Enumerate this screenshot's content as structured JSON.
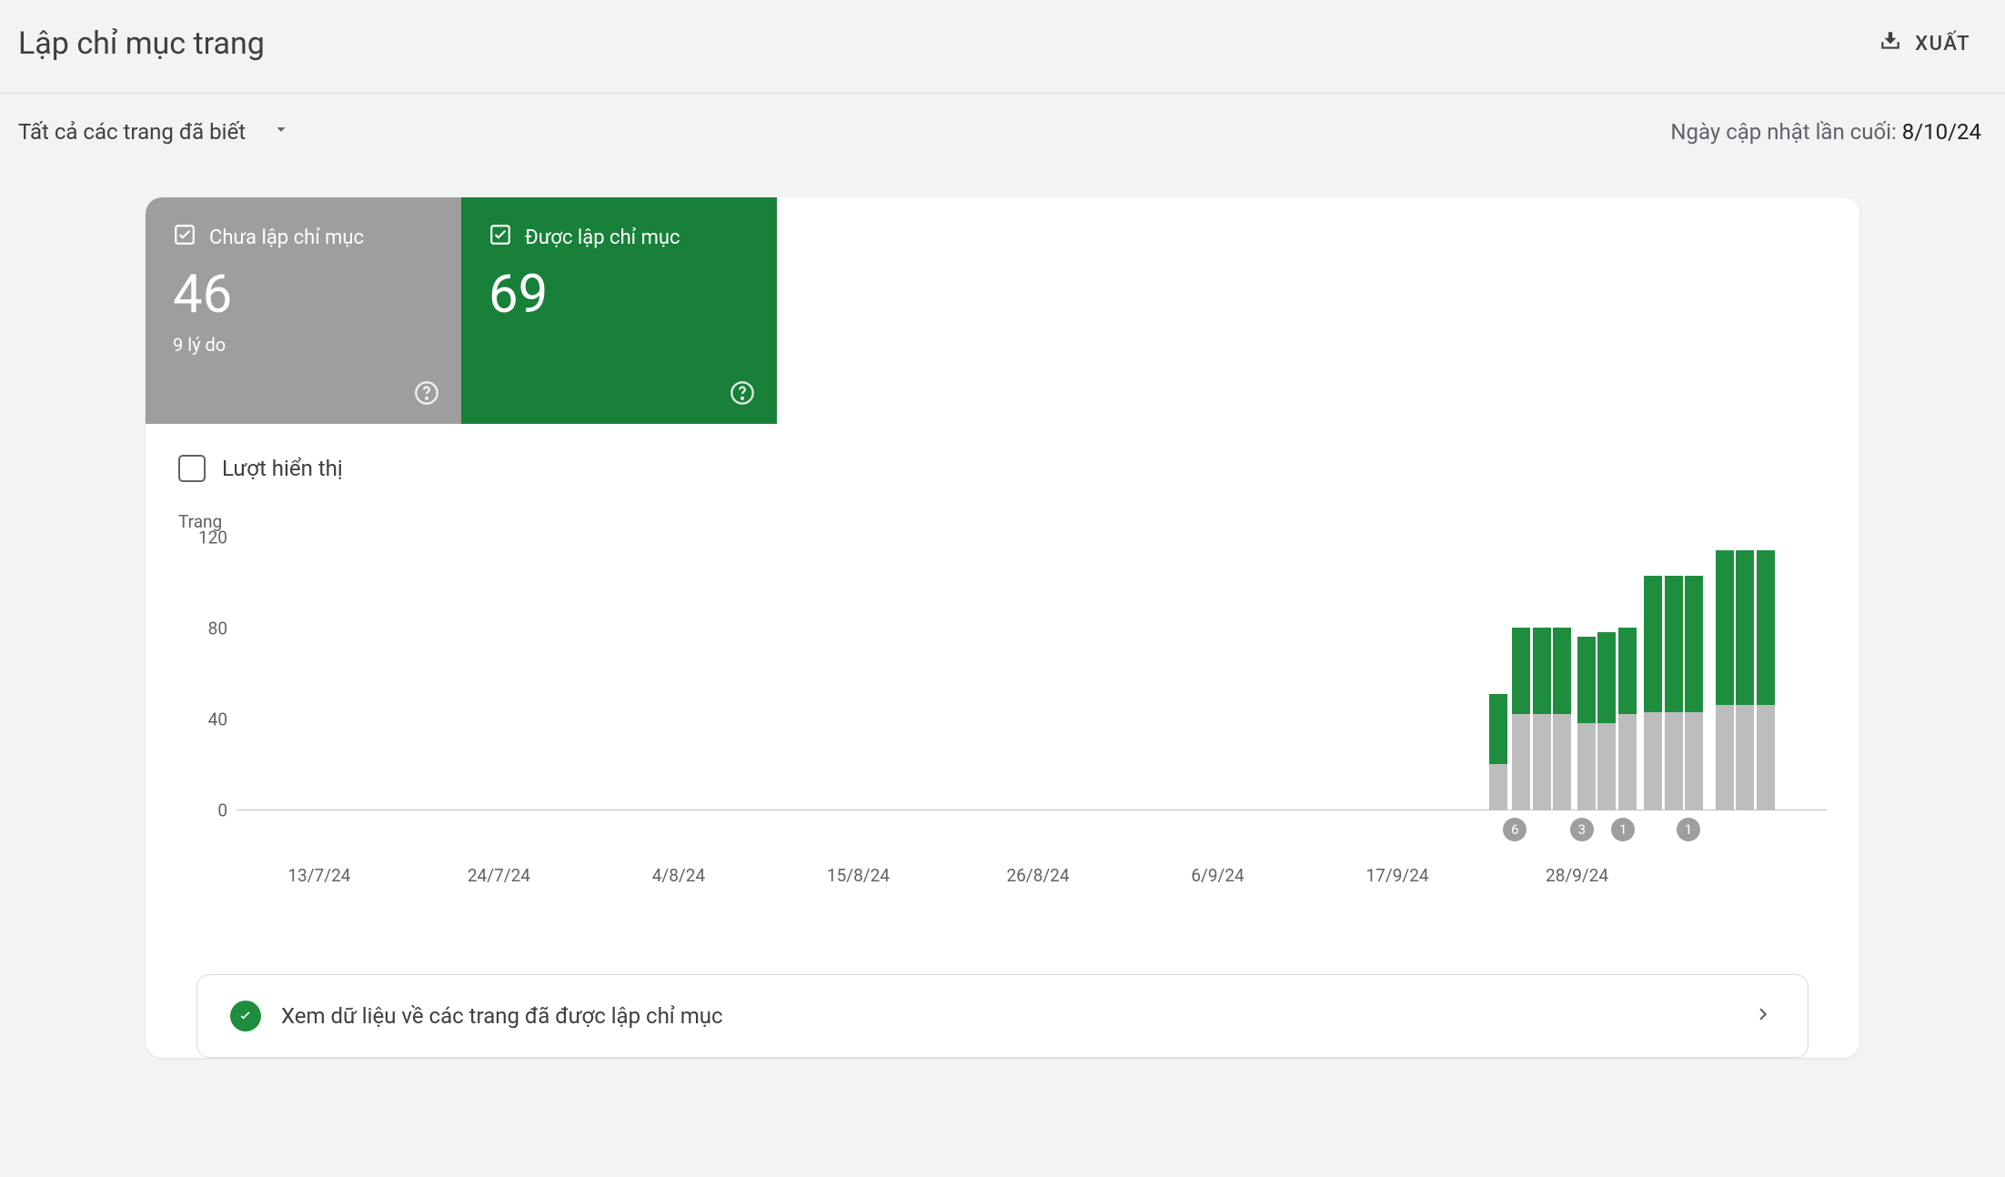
{
  "header": {
    "title": "Lập chỉ mục trang",
    "export_label": "XUẤT"
  },
  "subheader": {
    "filter_label": "Tất cả các trang đã biết",
    "last_updated_label": "Ngày cập nhật lần cuối: ",
    "last_updated_date": "8/10/24"
  },
  "tabs": {
    "not_indexed": {
      "label": "Chưa lập chỉ mục",
      "value": "46",
      "subtitle": "9 lý do"
    },
    "indexed": {
      "label": "Được lập chỉ mục",
      "value": "69"
    }
  },
  "impressions_label": "Lượt hiển thị",
  "chart_data": {
    "type": "bar",
    "ylabel": "Trang",
    "ylim": [
      0,
      120
    ],
    "yticks": [
      0,
      40,
      80,
      120
    ],
    "x_tick_labels": [
      "13/7/24",
      "24/7/24",
      "4/8/24",
      "15/8/24",
      "26/8/24",
      "6/9/24",
      "17/9/24",
      "28/9/24"
    ],
    "x_tick_positions_pct": [
      5.2,
      16.5,
      27.8,
      39.1,
      50.4,
      61.7,
      73.0,
      84.3
    ],
    "series_names": [
      "not_indexed",
      "indexed"
    ],
    "bars": [
      {
        "pos_pct": 78.8,
        "not_indexed": 20,
        "indexed": 31
      },
      {
        "pos_pct": 80.2,
        "not_indexed": 42,
        "indexed": 38
      },
      {
        "pos_pct": 81.5,
        "not_indexed": 42,
        "indexed": 38
      },
      {
        "pos_pct": 82.8,
        "not_indexed": 42,
        "indexed": 38
      },
      {
        "pos_pct": 84.3,
        "not_indexed": 38,
        "indexed": 38
      },
      {
        "pos_pct": 85.6,
        "not_indexed": 38,
        "indexed": 40
      },
      {
        "pos_pct": 86.9,
        "not_indexed": 42,
        "indexed": 38
      },
      {
        "pos_pct": 88.5,
        "not_indexed": 43,
        "indexed": 60
      },
      {
        "pos_pct": 89.8,
        "not_indexed": 43,
        "indexed": 60
      },
      {
        "pos_pct": 91.1,
        "not_indexed": 43,
        "indexed": 60
      },
      {
        "pos_pct": 93.0,
        "not_indexed": 46,
        "indexed": 68
      },
      {
        "pos_pct": 94.3,
        "not_indexed": 46,
        "indexed": 68
      },
      {
        "pos_pct": 95.6,
        "not_indexed": 46,
        "indexed": 68
      }
    ],
    "x_badges": [
      {
        "pos_pct": 80.4,
        "label": "6"
      },
      {
        "pos_pct": 84.6,
        "label": "3"
      },
      {
        "pos_pct": 87.2,
        "label": "1"
      },
      {
        "pos_pct": 91.3,
        "label": "1"
      }
    ]
  },
  "info_row": {
    "text": "Xem dữ liệu về các trang đã được lập chỉ mục"
  }
}
